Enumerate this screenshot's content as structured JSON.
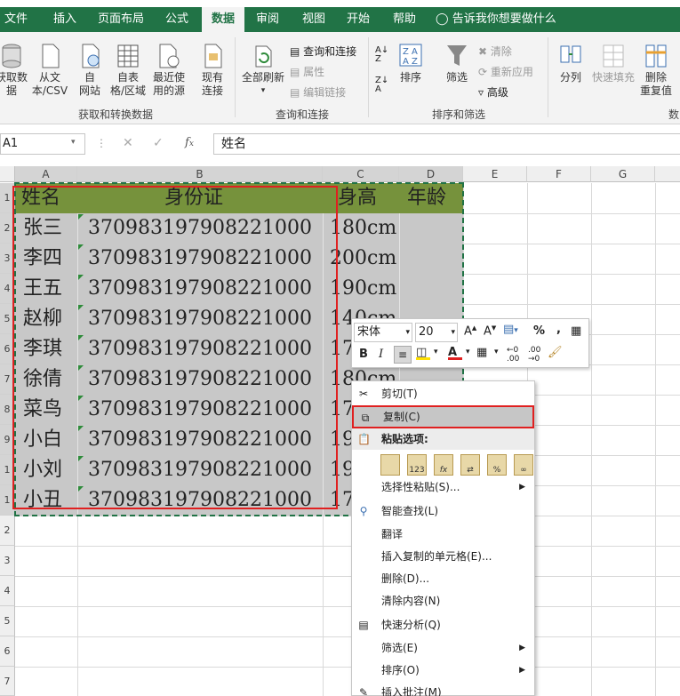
{
  "tabs": [
    "文件",
    "插入",
    "页面布局",
    "公式",
    "数据",
    "审阅",
    "视图",
    "开始",
    "帮助"
  ],
  "tell_me": "告诉我你想要做什么",
  "ribbon": {
    "get_data": "获取数\n据",
    "from_text": "从文\n本/CSV",
    "from_web": "自\n网站",
    "from_table": "自表\n格/区域",
    "recent": "最近使\n用的源",
    "existing": "现有\n连接",
    "refresh_all": "全部刷新",
    "queries": "查询和连接",
    "properties": "属性",
    "edit_links": "编辑链接",
    "sort": "排序",
    "filter": "筛选",
    "clear": "清除",
    "reapply": "重新应用",
    "advanced": "高级",
    "split": "分列",
    "flash_fill": "快速填充",
    "remove_dup": "删除\n重复值",
    "group_get": "获取和转换数据",
    "group_query": "查询和连接",
    "group_sort": "排序和筛选",
    "group_tools": "数"
  },
  "formula_bar": {
    "name_box": "A1",
    "content": "姓名"
  },
  "columns": [
    "A",
    "B",
    "C",
    "D",
    "E",
    "F",
    "G"
  ],
  "rows": [
    "1",
    "2",
    "3",
    "4",
    "5",
    "6",
    "7",
    "8",
    "9",
    "1",
    "1",
    "2",
    "3",
    "4",
    "5",
    "6",
    "7"
  ],
  "table": {
    "headers": [
      "姓名",
      "身份证",
      "身高",
      "年龄"
    ],
    "rows": [
      [
        "张三",
        "370983197908221000",
        "180cm"
      ],
      [
        "李四",
        "370983197908221000",
        "200cm"
      ],
      [
        "王五",
        "370983197908221000",
        "190cm"
      ],
      [
        "赵柳",
        "370983197908221000",
        "140cm"
      ],
      [
        "李琪",
        "370983197908221000",
        "17"
      ],
      [
        "徐倩",
        "370983197908221000",
        "180cm"
      ],
      [
        "菜鸟",
        "370983197908221000",
        "17"
      ],
      [
        "小白",
        "370983197908221000",
        "19"
      ],
      [
        "小刘",
        "370983197908221000",
        "19"
      ],
      [
        "小丑",
        "370983197908221000",
        "17"
      ]
    ]
  },
  "mini_toolbar": {
    "font": "宋体",
    "size": "20",
    "percent": "%",
    "comma": ","
  },
  "context_menu": {
    "cut": "剪切(T)",
    "copy": "复制(C)",
    "paste_options": "粘贴选项:",
    "paste_special": "选择性粘贴(S)...",
    "smart_lookup": "智能查找(L)",
    "translate": "翻译",
    "insert_copied": "插入复制的单元格(E)...",
    "delete": "删除(D)...",
    "clear": "清除内容(N)",
    "quick_analysis": "快速分析(Q)",
    "filter": "筛选(E)",
    "sort": "排序(O)",
    "insert_comment": "插入批注(M)"
  },
  "colors": {
    "excel_green": "#217346",
    "header_fill": "#76923c",
    "selected_fill": "#c8c8c8",
    "highlight_red": "#e02020"
  }
}
